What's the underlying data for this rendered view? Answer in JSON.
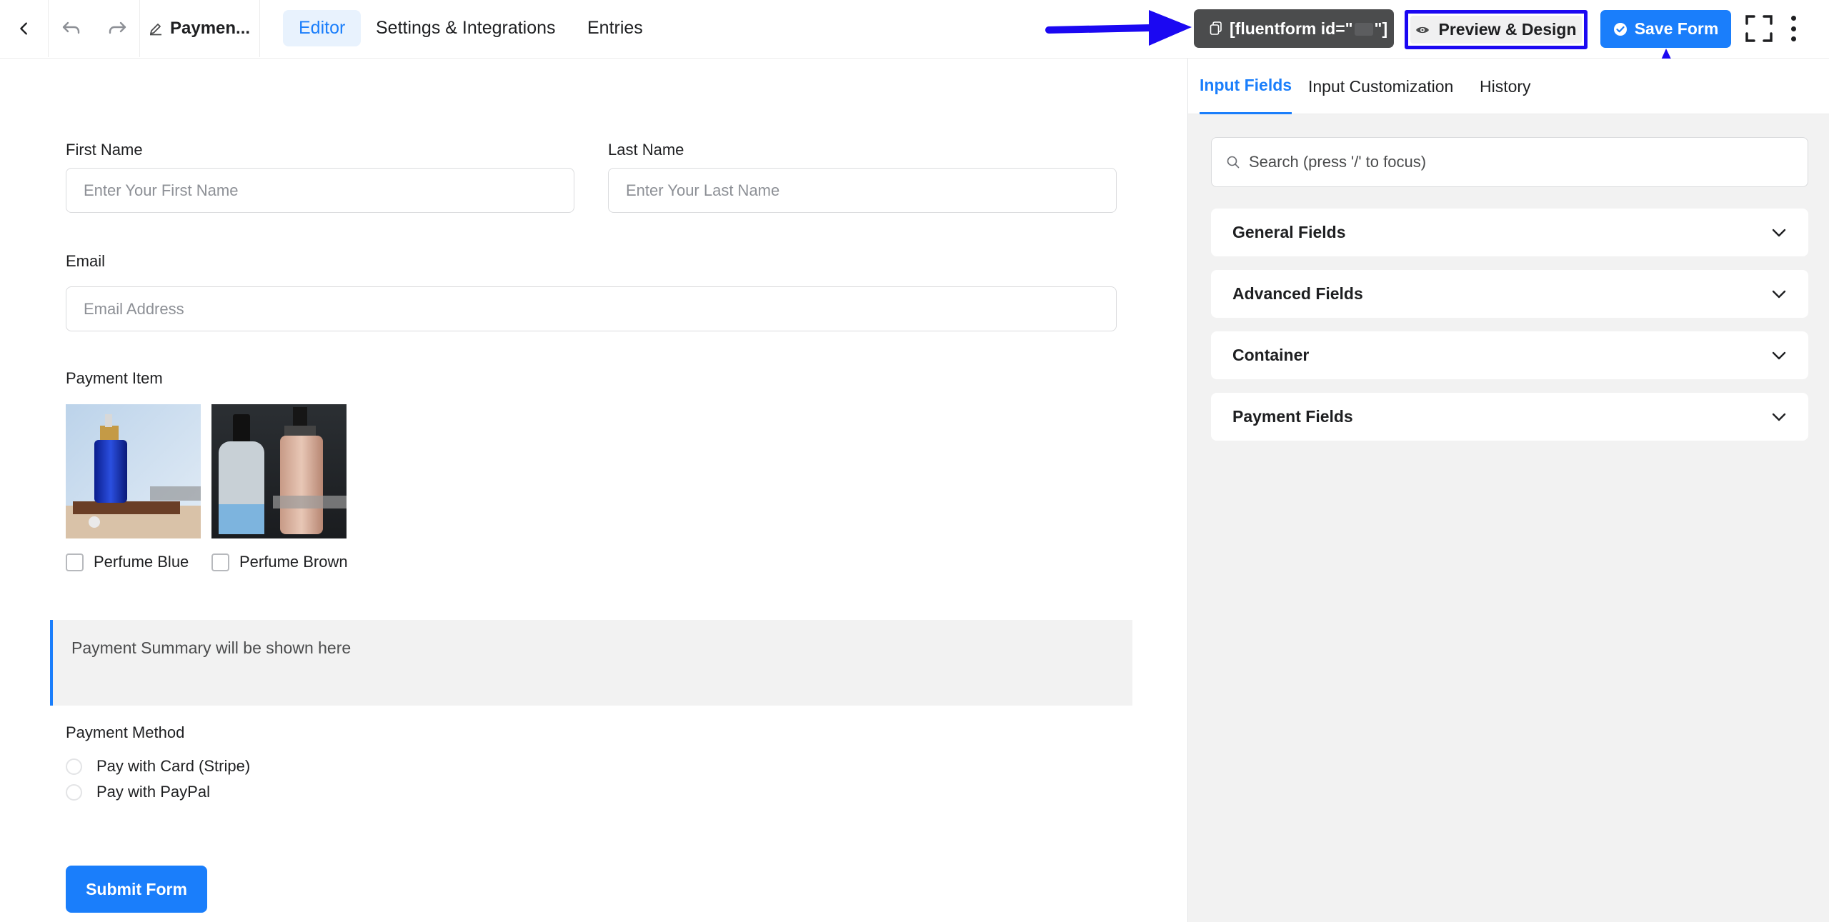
{
  "header": {
    "back_icon": "chevron-left-icon",
    "undo_icon": "undo-icon",
    "redo_icon": "redo-icon",
    "form_name": "Paymen...",
    "form_name_icon": "pencil-icon",
    "tabs": [
      {
        "label": "Editor",
        "active": true
      },
      {
        "label": "Settings & Integrations",
        "active": false
      },
      {
        "label": "Entries",
        "active": false
      }
    ],
    "shortcode_prefix": "[fluentform id=\"",
    "shortcode_suffix": "\"]",
    "preview_label": "Preview & Design",
    "save_label": "Save Form",
    "accent_color": "#1a7efb",
    "annotation_color": "#1b08f2"
  },
  "form": {
    "first_name": {
      "label": "First Name",
      "placeholder": "Enter Your First Name"
    },
    "last_name": {
      "label": "Last Name",
      "placeholder": "Enter Your Last Name"
    },
    "email": {
      "label": "Email",
      "placeholder": "Email Address"
    },
    "payment_item": {
      "label": "Payment Item",
      "options": [
        {
          "label": "Perfume Blue",
          "checked": false
        },
        {
          "label": "Perfume Brown",
          "checked": false
        }
      ]
    },
    "summary_text": "Payment Summary will be shown here",
    "payment_method": {
      "label": "Payment Method",
      "options": [
        {
          "label": "Pay with Card (Stripe)"
        },
        {
          "label": "Pay with PayPal"
        }
      ]
    },
    "submit_label": "Submit Form"
  },
  "panel": {
    "tabs": [
      {
        "label": "Input Fields",
        "active": true
      },
      {
        "label": "Input Customization",
        "active": false
      },
      {
        "label": "History",
        "active": false
      }
    ],
    "search_placeholder": "Search (press '/' to focus)",
    "sections": [
      {
        "label": "General Fields"
      },
      {
        "label": "Advanced Fields"
      },
      {
        "label": "Container"
      },
      {
        "label": "Payment Fields"
      }
    ]
  }
}
